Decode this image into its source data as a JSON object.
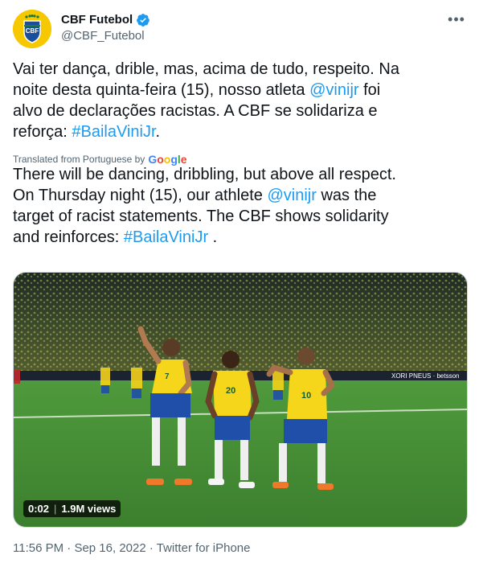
{
  "account": {
    "display_name": "CBF Futebol",
    "handle": "@CBF_Futebol",
    "verified": true,
    "avatar_text": "CBF"
  },
  "tweet": {
    "line1": "Vai ter dança, drible, mas, acima de tudo, respeito. Na",
    "line2_pre": "noite desta quinta-feira (15), nosso atleta ",
    "mention": "@vinijr",
    "line2_post": " foi",
    "line3": "alvo de declarações racistas. A CBF se solidariza e",
    "line4_pre": "reforça: ",
    "hashtag": "#BailaViniJr",
    "line4_post": "."
  },
  "translated": {
    "label": "Translated from Portuguese by",
    "provider": "Google"
  },
  "translation": {
    "text1": "There will be dancing, dribbling, but above all respect.",
    "text2_pre": "On Thursday night (15), our athlete ",
    "mention": "@vinijr",
    "text2_post": " was the",
    "text3": "target of racist statements. The CBF shows solidarity",
    "text4_pre": "and reinforces: ",
    "hashtag": "#BailaViniJr",
    "text4_post": " ."
  },
  "media": {
    "duration": "0:02",
    "views": "1.9M views",
    "jersey_numbers": [
      "7",
      "20",
      "10"
    ],
    "board_text": "XORI PNEUS · betsson"
  },
  "meta": {
    "time": "11:56 PM",
    "date": "Sep 16, 2022",
    "source": "Twitter for iPhone",
    "sep": "·"
  },
  "colors": {
    "link": "#1d9bf0",
    "verified": "#1d9bf0",
    "secondary": "#536471"
  }
}
